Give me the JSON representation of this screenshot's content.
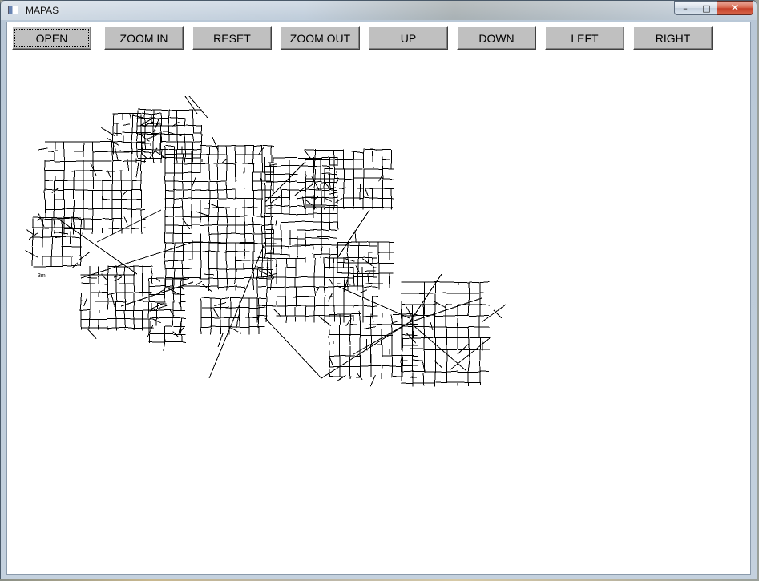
{
  "window": {
    "title": "MAPAS",
    "minimize": "–",
    "maximize": "□",
    "close": "✕"
  },
  "toolbar": {
    "buttons": [
      {
        "label": "OPEN"
      },
      {
        "label": "ZOOM IN"
      },
      {
        "label": "RESET"
      },
      {
        "label": "ZOOM OUT"
      },
      {
        "label": "UP"
      },
      {
        "label": "DOWN"
      },
      {
        "label": "LEFT"
      },
      {
        "label": "RIGHT"
      }
    ]
  },
  "map": {
    "label": "3m",
    "line_color": "#000000",
    "background": "#ffffff"
  }
}
